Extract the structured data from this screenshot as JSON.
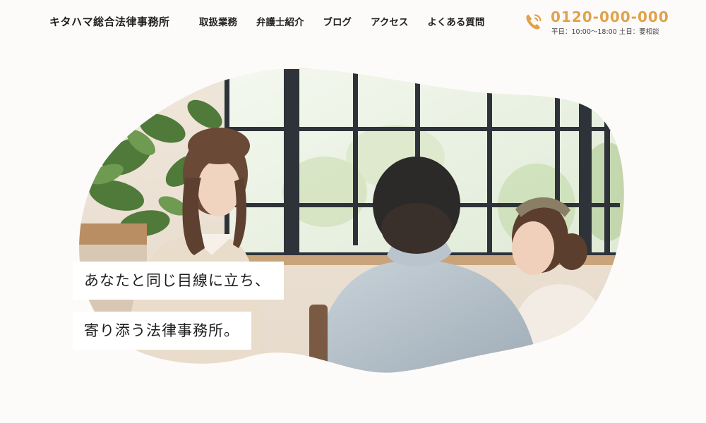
{
  "header": {
    "logo_text": "キタハマ総合法律事務所",
    "nav": [
      {
        "label": "取扱業務"
      },
      {
        "label": "弁護士紹介"
      },
      {
        "label": "ブログ"
      },
      {
        "label": "アクセス"
      },
      {
        "label": "よくある質問"
      }
    ],
    "contact": {
      "phone": "0120-000-000",
      "hours": "平日：10:00〜18:00 土日：要相談",
      "icon": "phone-icon"
    }
  },
  "hero": {
    "tagline_line1": "あなたと同じ目線に立ち、",
    "tagline_line2": "寄り添う法律事務所。"
  },
  "colors": {
    "background": "#fdfbf9",
    "accent": "#e0a24a",
    "text": "#222222",
    "tagline_bg": "#ffffff"
  }
}
